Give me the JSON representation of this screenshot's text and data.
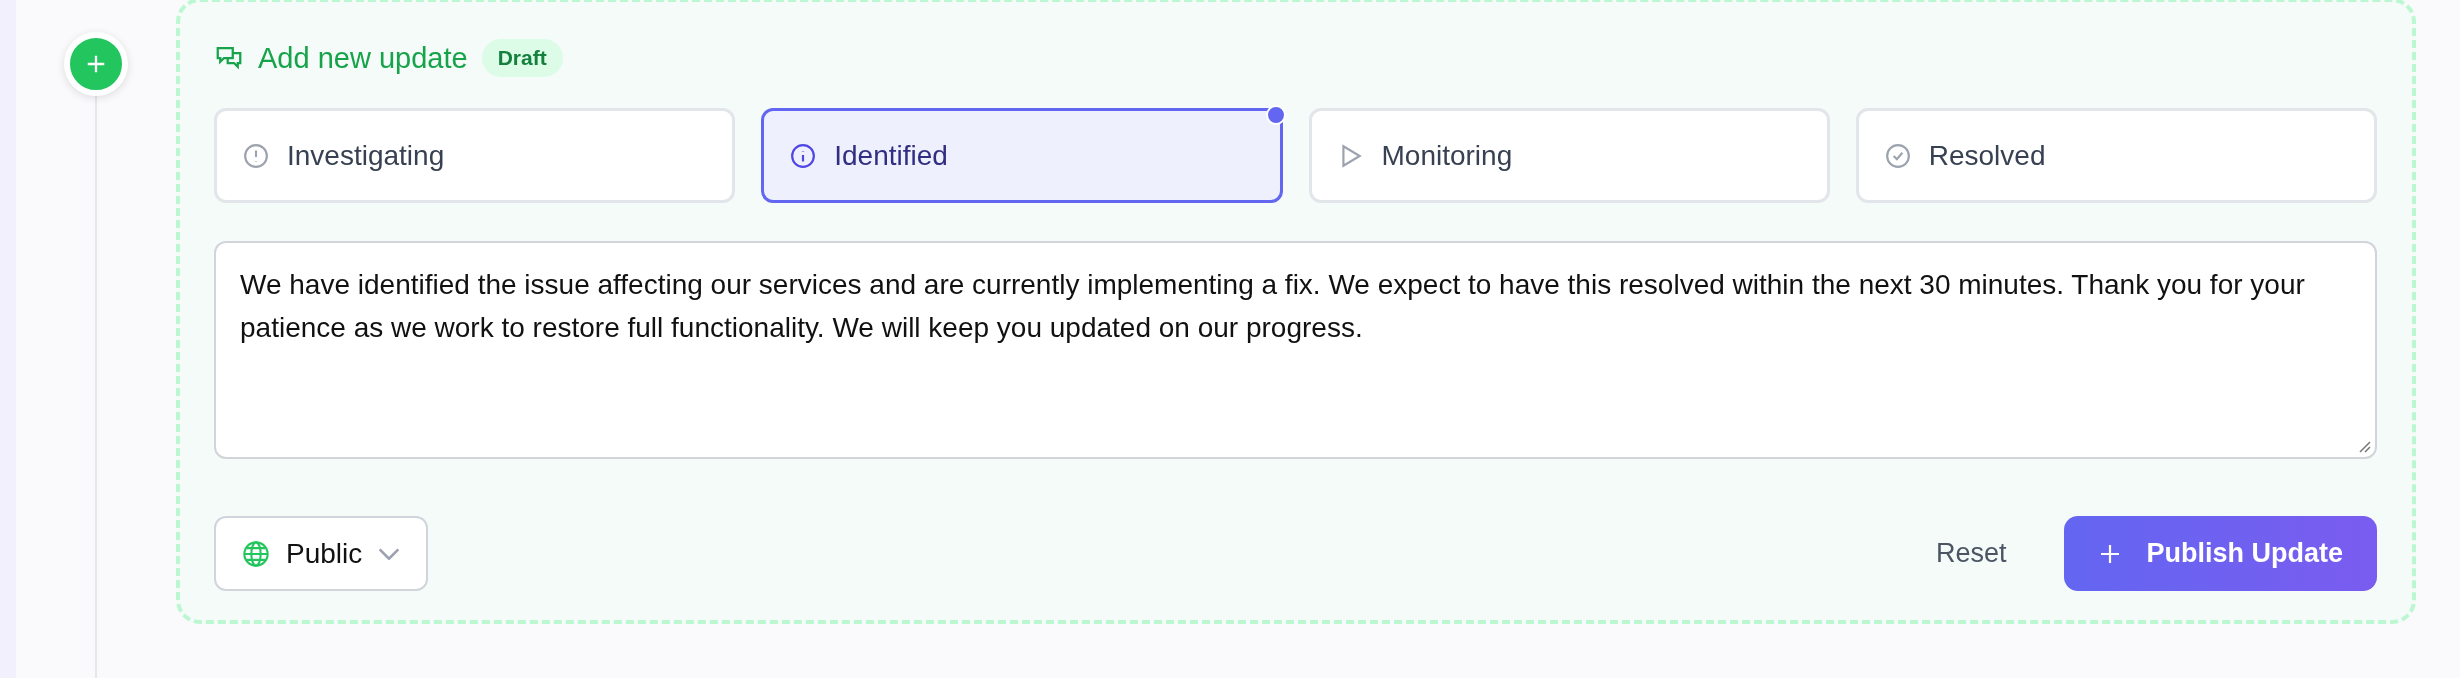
{
  "header": {
    "title": "Add new update",
    "badge": "Draft"
  },
  "statuses": [
    {
      "label": "Investigating",
      "kind": "alert",
      "selected": false
    },
    {
      "label": "Identified",
      "kind": "info",
      "selected": true
    },
    {
      "label": "Monitoring",
      "kind": "play",
      "selected": false
    },
    {
      "label": "Resolved",
      "kind": "check",
      "selected": false
    }
  ],
  "message": {
    "value": "We have identified the issue affecting our services and are currently implementing a fix. We expect to have this resolved within the next 30 minutes. Thank you for your patience as we work to restore full functionality. We will keep you updated on our progress."
  },
  "visibility": {
    "value": "Public"
  },
  "buttons": {
    "reset": "Reset",
    "publish": "Publish Update"
  }
}
